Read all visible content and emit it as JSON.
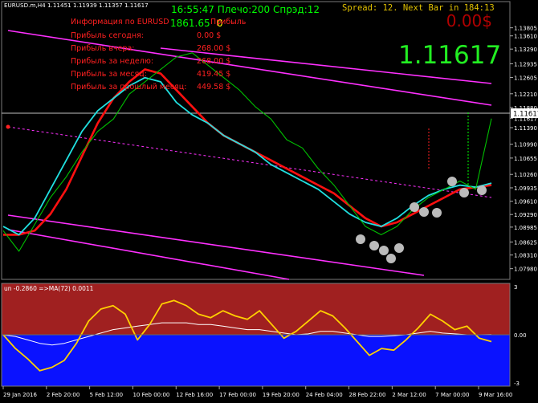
{
  "header": {
    "symbol_line": "EURUSD.m,H4  1.11451 1.11939 1.11357 1.11617",
    "spread_line": "Spread: 12. Next Bar in 184:13",
    "status_line": "16:55:47 Плечо:200 Спрэд:12",
    "balance": "1861.65",
    "balance_zero": "0",
    "profit_display": "0.00$",
    "price_display": "1.11617"
  },
  "info_panel": {
    "rows": [
      {
        "label": "Информация по EURUSD",
        "value": "Прибыль"
      },
      {
        "label": "Прибыль сегодня:",
        "value": "0.00 $"
      },
      {
        "label": "Прибыль вчера:",
        "value": "268.00 $"
      },
      {
        "label": "Прибыль за неделю:",
        "value": "268.00 $"
      },
      {
        "label": "Прибыль за месяц:",
        "value": "419.45 $"
      },
      {
        "label": "Прибыль за прошлый месяц:",
        "value": "449.58 $"
      }
    ]
  },
  "colors": {
    "background": "#000000",
    "price_line": "#00c000",
    "ma_fast": "#20e0e0",
    "ma_slow": "#ff1010",
    "channel": "#ff30ff",
    "indicator_line": "#ffd000",
    "indicator_signal": "#ffffff",
    "upper_zone": "#a02020",
    "lower_zone": "#0a12ff",
    "axis_text": "#ffffff",
    "info_text": "#ff2020",
    "status_text": "#00ff00",
    "spread_text": "#e0c000"
  },
  "chart_data": [
    {
      "type": "line",
      "ylim": [
        1.0776,
        1.144
      ],
      "y_ticks": [
        "1.13805",
        "1.13610",
        "1.13290",
        "1.12935",
        "1.12605",
        "1.12210",
        "1.11880",
        "1.11617",
        "1.11390",
        "1.10990",
        "1.10655",
        "1.10260",
        "1.09935",
        "1.09610",
        "1.09290",
        "1.08985",
        "1.08625",
        "1.08310",
        "1.07980"
      ],
      "current_price": "1.11617",
      "x_ticks": [
        "29 Jan 2016",
        "2 Feb 20:00",
        "5 Feb 12:00",
        "10 Feb 00:00",
        "12 Feb 16:00",
        "17 Feb 00:00",
        "19 Feb 20:00",
        "24 Feb 04:00",
        "28 Feb 22:00",
        "2 Mar 12:00",
        "7 Mar 00:00",
        "9 Mar 16:00"
      ],
      "series": [
        {
          "values": [
            1.089,
            1.084,
            1.0905,
            1.097,
            1.102,
            1.108,
            1.113,
            1.116,
            1.122,
            1.125,
            1.128,
            1.131,
            1.132,
            1.129,
            1.126,
            1.123,
            1.119,
            1.116,
            1.111,
            1.109,
            1.104,
            1.1,
            1.095,
            1.09,
            1.088,
            1.09,
            1.094,
            1.097,
            1.099,
            1.101,
            1.099,
            1.1161
          ]
        },
        {
          "values": [
            1.09,
            1.088,
            1.092,
            1.099,
            1.106,
            1.113,
            1.118,
            1.121,
            1.124,
            1.126,
            1.125,
            1.12,
            1.117,
            1.115,
            1.112,
            1.11,
            1.108,
            1.105,
            1.103,
            1.101,
            1.099,
            1.096,
            1.093,
            1.091,
            1.09,
            1.092,
            1.095,
            1.0975,
            1.099,
            1.1,
            1.0995,
            1.1005
          ]
        },
        {
          "values": [
            1.088,
            1.088,
            1.089,
            1.093,
            1.099,
            1.107,
            1.115,
            1.121,
            1.125,
            1.128,
            1.127,
            1.123,
            1.119,
            1.115,
            1.112,
            1.11,
            1.108,
            1.106,
            1.104,
            1.102,
            1.1,
            1.098,
            1.095,
            1.092,
            1.09,
            1.091,
            1.093,
            1.095,
            1.097,
            1.099,
            1.0995,
            1.1
          ]
        }
      ]
    },
    {
      "type": "line",
      "title": "un -0.2860  =>MA(72) 0.0011",
      "ylim": [
        -3,
        3
      ],
      "y_ticks": [
        "3",
        "0.00",
        "-3"
      ],
      "series": [
        {
          "values": [
            0.0,
            -0.8,
            -1.4,
            -2.1,
            -1.9,
            -1.5,
            -0.5,
            0.8,
            1.5,
            1.7,
            1.2,
            -0.3,
            0.6,
            1.8,
            2.0,
            1.7,
            1.2,
            1.0,
            1.4,
            1.1,
            0.9,
            1.4,
            0.6,
            -0.2,
            0.2,
            0.8,
            1.4,
            1.1,
            0.4,
            -0.4,
            -1.2,
            -0.8,
            -0.9,
            -0.3,
            0.4,
            1.2,
            0.8,
            0.3,
            0.5,
            -0.2,
            -0.4
          ]
        },
        {
          "values": [
            0.0,
            -0.1,
            -0.3,
            -0.5,
            -0.6,
            -0.5,
            -0.3,
            -0.1,
            0.1,
            0.3,
            0.4,
            0.5,
            0.6,
            0.7,
            0.7,
            0.7,
            0.6,
            0.6,
            0.5,
            0.4,
            0.3,
            0.3,
            0.2,
            0.1,
            0.0,
            0.05,
            0.2,
            0.2,
            0.1,
            0.0,
            -0.1,
            -0.1,
            -0.05,
            0.0,
            0.1,
            0.2,
            0.1,
            0.05,
            0.0,
            0.0,
            0.01
          ]
        }
      ]
    }
  ]
}
